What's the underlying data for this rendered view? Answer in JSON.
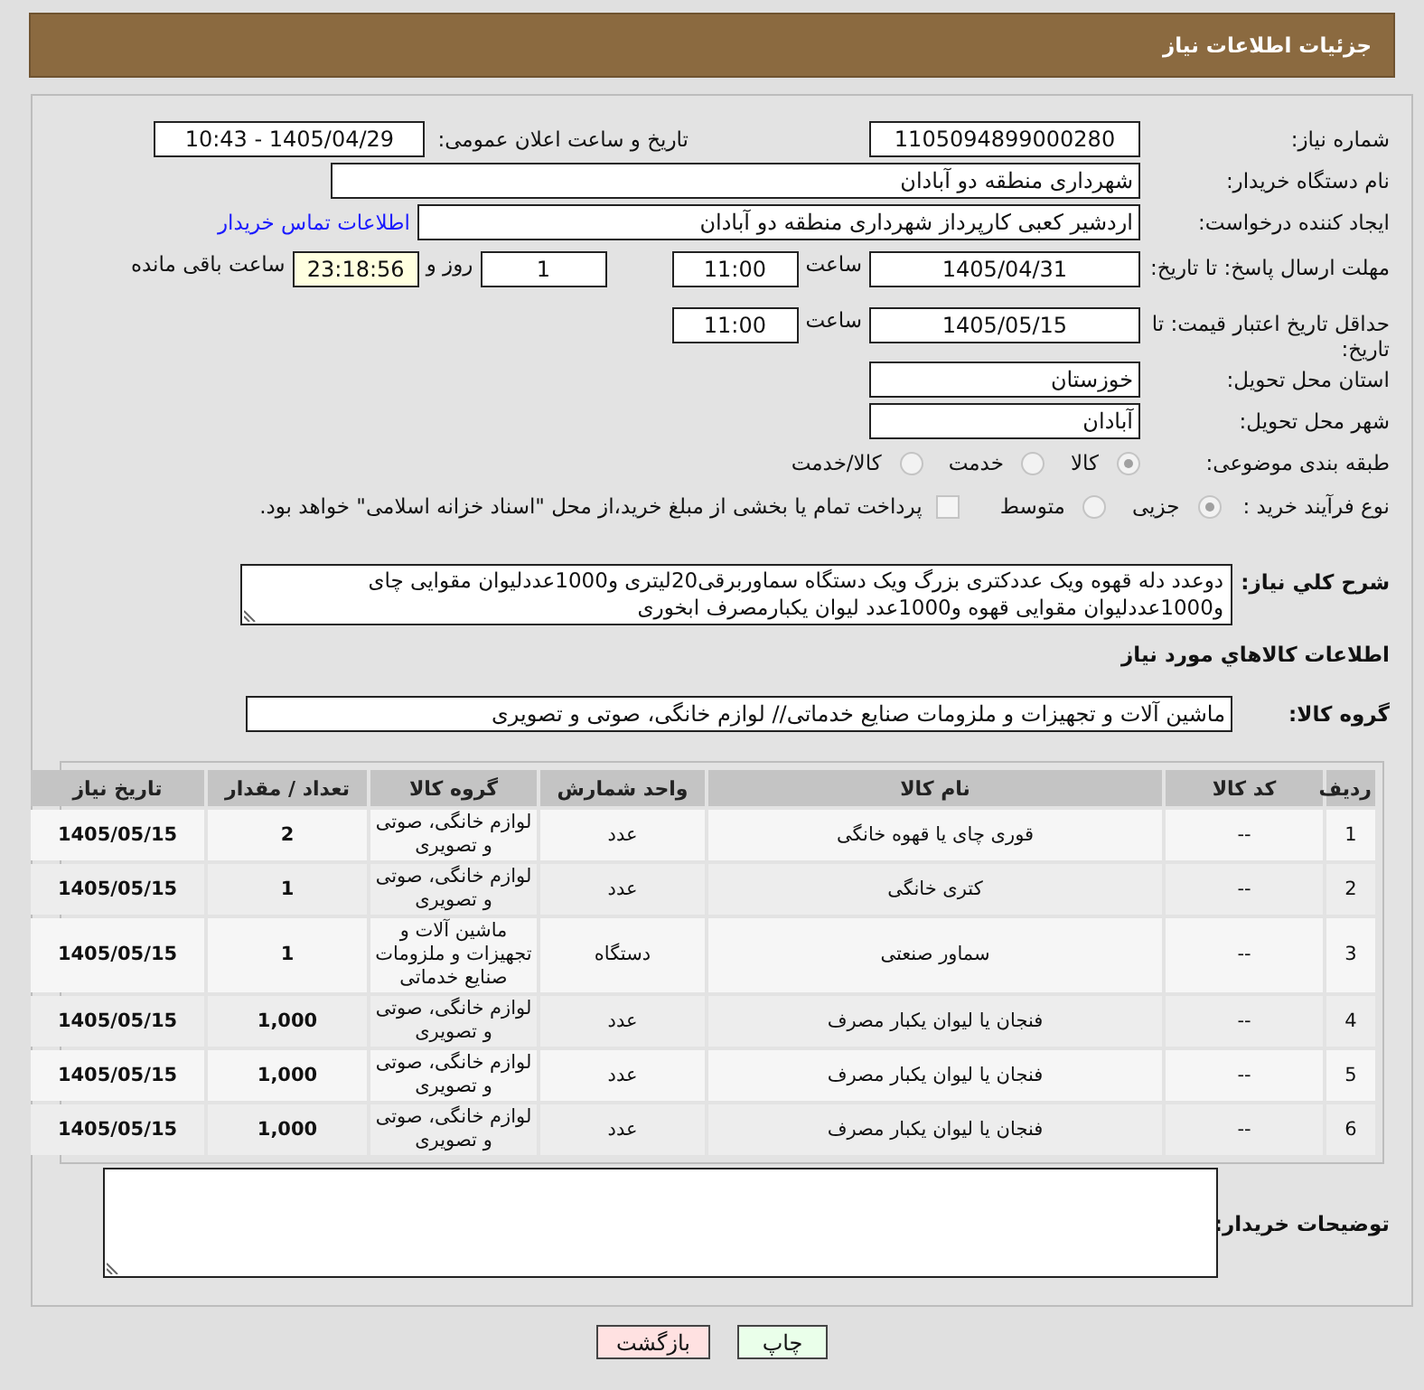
{
  "header": {
    "title": "جزئیات اطلاعات نیاز"
  },
  "details": {
    "need_number": {
      "label": "شماره نیاز:",
      "value": "1105094899000280"
    },
    "announce": {
      "label": "تاریخ و ساعت اعلان عمومی:",
      "value": "1405/04/29 - 10:43"
    },
    "buyer_org": {
      "label": "نام دستگاه خریدار:",
      "value": "شهرداری منطقه دو آبادان"
    },
    "requester": {
      "label": "ایجاد کننده درخواست:",
      "value": "اردشیر کعبی کارپرداز شهرداری منطقه دو آبادان",
      "contact_link": "اطلاعات تماس خریدار"
    },
    "reply_deadline": {
      "label": "مهلت ارسال پاسخ: تا تاریخ:",
      "date": "1405/04/31",
      "time_label": "ساعت",
      "time": "11:00",
      "days": "1",
      "days_label": "روز و",
      "remaining": "23:18:56",
      "remaining_label": "ساعت باقی مانده"
    },
    "price_validity": {
      "label": "حداقل تاریخ اعتبار قیمت: تا تاریخ:",
      "date": "1405/05/15",
      "time_label": "ساعت",
      "time": "11:00"
    },
    "province": {
      "label": "استان محل تحویل:",
      "value": "خوزستان"
    },
    "city": {
      "label": "شهر محل تحویل:",
      "value": "آبادان"
    },
    "category": {
      "label": "طبقه بندی موضوعی:",
      "options": [
        {
          "label": "کالا",
          "selected": true
        },
        {
          "label": "خدمت",
          "selected": false
        },
        {
          "label": "کالا/خدمت",
          "selected": false
        }
      ]
    },
    "purchase_type": {
      "label": "نوع فرآیند خرید :",
      "options": [
        {
          "label": "جزیی",
          "selected": true
        },
        {
          "label": "متوسط",
          "selected": false
        }
      ],
      "treasury": {
        "label": "پرداخت تمام یا بخشی از مبلغ خرید،از محل \"اسناد خزانه اسلامی\" خواهد بود.",
        "checked": false
      }
    },
    "description": {
      "label": "شرح كلي نياز:",
      "value": "دوعدد دله قهوه ویک عددکتری بزرگ ویک دستگاه سماوربرقی20لیتری و1000عددلیوان مقوایی چای و1000عددلیوان مقوایی قهوه و1000عدد لیوان یکبارمصرف ابخوری"
    }
  },
  "goods": {
    "title": "اطلاعات كالاهاي مورد نياز",
    "group_label": "گروه كالا:",
    "group_value": "ماشین آلات و تجهیزات و ملزومات صنایع خدماتی// لوازم خانگی، صوتی و تصویری",
    "table": {
      "columns": [
        "ردیف",
        "کد کالا",
        "نام کالا",
        "واحد شمارش",
        "گروه کالا",
        "تعداد / مقدار",
        "تاریخ نیاز"
      ],
      "rows": [
        [
          "1",
          "--",
          "قوری چای یا قهوه خانگی",
          "عدد",
          "لوازم خانگی، صوتی و تصویری",
          "2",
          "1405/05/15"
        ],
        [
          "2",
          "--",
          "کتری خانگی",
          "عدد",
          "لوازم خانگی، صوتی و تصویری",
          "1",
          "1405/05/15"
        ],
        [
          "3",
          "--",
          "سماور صنعتی",
          "دستگاه",
          "ماشین آلات و تجهیزات و ملزومات صنایع خدماتی",
          "1",
          "1405/05/15"
        ],
        [
          "4",
          "--",
          "فنجان یا لیوان یکبار مصرف",
          "عدد",
          "لوازم خانگی، صوتی و تصویری",
          "1,000",
          "1405/05/15"
        ],
        [
          "5",
          "--",
          "فنجان یا لیوان یکبار مصرف",
          "عدد",
          "لوازم خانگی، صوتی و تصویری",
          "1,000",
          "1405/05/15"
        ],
        [
          "6",
          "--",
          "فنجان یا لیوان یکبار مصرف",
          "عدد",
          "لوازم خانگی، صوتی و تصویری",
          "1,000",
          "1405/05/15"
        ]
      ]
    }
  },
  "buyer_notes": {
    "label": "توضیحات خریدار:"
  },
  "buttons": [
    {
      "label": "چاپ",
      "kind": "print"
    },
    {
      "label": "بازگشت",
      "kind": "back"
    }
  ]
}
